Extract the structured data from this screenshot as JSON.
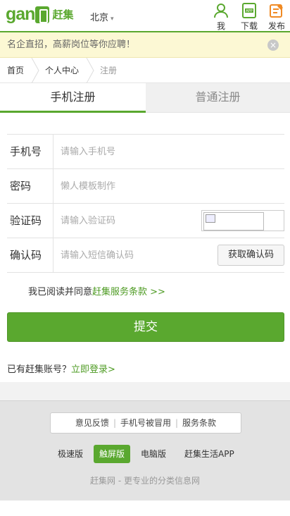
{
  "header": {
    "logo_text": "gan",
    "logo_cn": "赶集",
    "city": "北京",
    "buttons": [
      {
        "label": "我",
        "icon": "user-icon"
      },
      {
        "label": "下载",
        "icon": "app-download-icon"
      },
      {
        "label": "发布",
        "icon": "post-edit-icon"
      }
    ],
    "app_badge": "APP"
  },
  "notice": {
    "text": "名企直招，高薪岗位等你应聘！",
    "close": "×"
  },
  "breadcrumb": {
    "items": [
      "首页",
      "个人中心",
      "注册"
    ]
  },
  "tabs": [
    {
      "label": "手机注册",
      "active": true
    },
    {
      "label": "普通注册",
      "active": false
    }
  ],
  "form": {
    "phone": {
      "label": "手机号",
      "placeholder": "请输入手机号"
    },
    "password": {
      "label": "密码",
      "placeholder": "懒人模板制作"
    },
    "captcha": {
      "label": "验证码",
      "placeholder": "请输入验证码"
    },
    "sms": {
      "label": "确认码",
      "placeholder": "请输入短信确认码",
      "button": "获取确认码"
    }
  },
  "agreement": {
    "prefix": "我已阅读并同意",
    "link": "赶集服务条款 >>"
  },
  "submit_label": "提交",
  "login": {
    "prefix": "已有赶集账号？",
    "link": "立即登录>"
  },
  "footer": {
    "links": [
      "意见反馈",
      "手机号被冒用",
      "服务条款"
    ],
    "versions": [
      {
        "label": "极速版",
        "active": false
      },
      {
        "label": "触屏版",
        "active": true
      },
      {
        "label": "电脑版",
        "active": false
      },
      {
        "label": "赶集生活APP",
        "active": false
      }
    ],
    "slogan": "赶集网 - 更专业的分类信息网"
  },
  "colors": {
    "brand": "#5aa82f",
    "notice_bg": "#fcf8d4"
  }
}
